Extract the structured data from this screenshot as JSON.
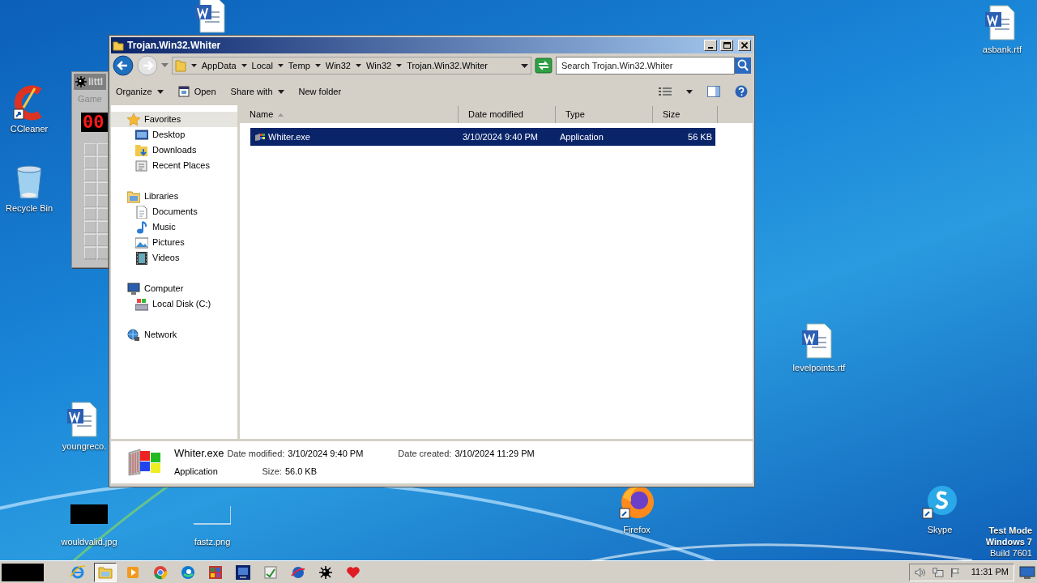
{
  "desktop_icons": [
    {
      "kind": "word"
    },
    {
      "kind": "word",
      "label": "asbank.rtf"
    },
    {
      "kind": "ccleaner",
      "label": "CCleaner"
    },
    {
      "kind": "recycle",
      "label": "Recycle Bin"
    },
    {
      "kind": "word",
      "label": "levelpoints.rtf"
    },
    {
      "kind": "word",
      "label": "youngreco."
    },
    {
      "kind": "black_image",
      "label": "wouldvalid.jpg"
    },
    {
      "kind": "blank_image",
      "label": "fastz.png"
    },
    {
      "kind": "firefox",
      "label": "Firefox"
    },
    {
      "kind": "skype",
      "label": "Skype"
    }
  ],
  "minesweeper": {
    "title": "littl",
    "menu": "Game",
    "counter": "00"
  },
  "explorer": {
    "title": "Trojan.Win32.Whiter",
    "breadcrumb": [
      "AppData",
      "Local",
      "Temp",
      "Win32",
      "Win32",
      "Trojan.Win32.Whiter"
    ],
    "search": {
      "placeholder": "Search Trojan.Win32.Whiter"
    },
    "toolbar": [
      {
        "label": "Organize",
        "dropdown": true,
        "kind": "text"
      },
      {
        "label": "Open",
        "dropdown": false,
        "kind": "open"
      },
      {
        "label": "Share with",
        "dropdown": true,
        "kind": "text"
      },
      {
        "label": "New folder",
        "dropdown": false,
        "kind": "text"
      }
    ],
    "nav": [
      {
        "label": "Favorites",
        "kind": "star",
        "selected": true,
        "children": [
          {
            "label": "Desktop",
            "kind": "desktop",
            "selected": false
          },
          {
            "label": "Downloads",
            "kind": "downloads",
            "selected": false
          },
          {
            "label": "Recent Places",
            "kind": "recent",
            "selected": false
          }
        ]
      },
      {
        "label": "Libraries",
        "kind": "libraries",
        "selected": false,
        "children": [
          {
            "label": "Documents",
            "kind": "documents",
            "selected": false
          },
          {
            "label": "Music",
            "kind": "music",
            "selected": false
          },
          {
            "label": "Pictures",
            "kind": "pictures",
            "selected": false
          },
          {
            "label": "Videos",
            "kind": "videos",
            "selected": false
          }
        ]
      },
      {
        "label": "Computer",
        "kind": "computer",
        "selected": false,
        "children": [
          {
            "label": "Local Disk (C:)",
            "kind": "disk",
            "selected": false
          }
        ]
      },
      {
        "label": "Network",
        "kind": "network",
        "selected": false
      }
    ],
    "columns": [
      {
        "label": "Name",
        "sorted": true
      },
      {
        "label": "Date modified",
        "sorted": false
      },
      {
        "label": "Type",
        "sorted": false
      },
      {
        "label": "Size",
        "sorted": false
      }
    ],
    "rows": [
      {
        "name": "Whiter.exe",
        "date_modified": "3/10/2024 9:40 PM",
        "type": "Application",
        "size": "56 KB",
        "selected": true
      }
    ],
    "details": {
      "name": "Whiter.exe",
      "type": "Application",
      "fields": [
        {
          "label": "Date modified:",
          "value": "3/10/2024 9:40 PM"
        },
        {
          "label": "Size:",
          "value": "56.0 KB"
        },
        {
          "label": "Date created:",
          "value": "3/10/2024 11:29 PM"
        }
      ]
    }
  },
  "os_notice": [
    "Test Mode",
    "Windows 7",
    "Build 7601"
  ],
  "taskbar": {
    "items": [
      {
        "kind": "ie",
        "selected": false
      },
      {
        "kind": "explorer",
        "selected": true
      },
      {
        "kind": "media",
        "selected": false
      },
      {
        "kind": "chrome",
        "selected": false
      },
      {
        "kind": "edge",
        "selected": false
      },
      {
        "kind": "grid",
        "selected": false
      },
      {
        "kind": "monitor",
        "selected": false
      },
      {
        "kind": "setup",
        "selected": false
      },
      {
        "kind": "globe",
        "selected": false
      },
      {
        "kind": "mine",
        "selected": false
      },
      {
        "kind": "heart",
        "selected": false
      }
    ],
    "clock": "11:31 PM"
  }
}
